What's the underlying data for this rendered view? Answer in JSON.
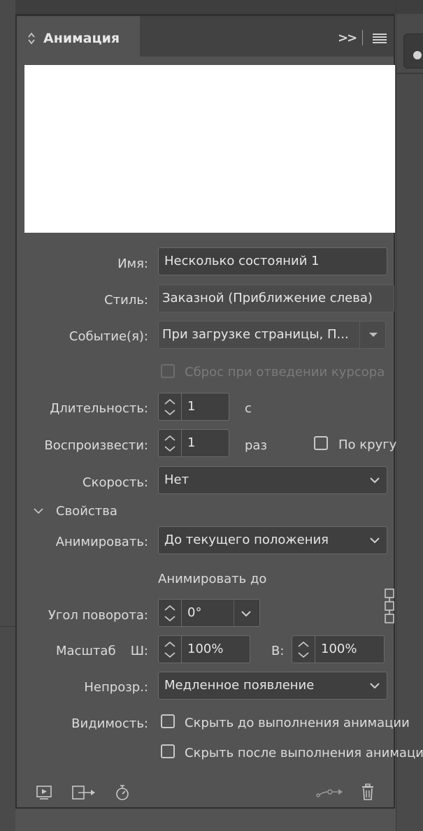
{
  "panel": {
    "title": "Анимация",
    "expand_icon": ">>",
    "menu_icon": "menu-icon"
  },
  "form": {
    "name_label": "Имя:",
    "name_value": "Несколько состояний 1",
    "style_label": "Стиль:",
    "style_value": "Заказной (Приближение слева)",
    "event_label": "Событие(я):",
    "event_value": "При загрузке страницы, П...",
    "reset_label": "Сброс при отведении курсора",
    "duration_label": "Длительность:",
    "duration_value": "1",
    "duration_unit": "с",
    "play_label": "Воспроизвести:",
    "play_value": "1",
    "play_unit": "раз",
    "loop_label": "По кругу",
    "speed_label": "Скорость:",
    "speed_value": "Нет",
    "properties_label": "Свойства",
    "animate_label": "Анимировать:",
    "animate_value": "До текущего положения",
    "animate_to_label": "Анимировать до",
    "rotation_label": "Угол поворота:",
    "rotation_value": "0°",
    "scale_label": "Масштаб",
    "scale_w_label": "Ш:",
    "scale_w_value": "100%",
    "scale_h_label": "В:",
    "scale_h_value": "100%",
    "opacity_label": "Непрозр.:",
    "opacity_value": "Медленное появление",
    "visibility_label": "Видимость:",
    "hide_before_label": "Скрыть до выполнения анимации",
    "hide_after_label": "Скрыть после выполнения анимации"
  },
  "colors": {
    "panel_bg": "#535353",
    "field_bg": "#3f3f3f",
    "preview_bg": "#ffffff"
  }
}
